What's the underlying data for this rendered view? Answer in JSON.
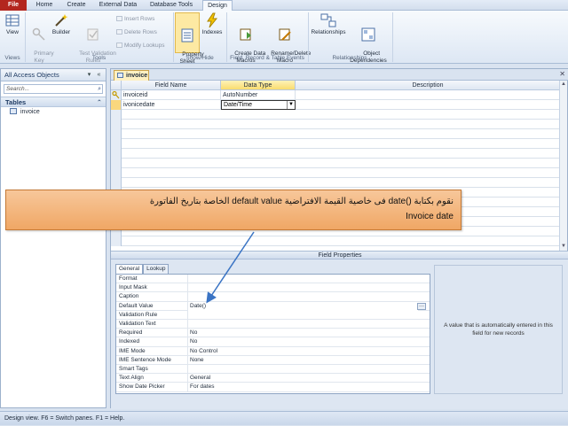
{
  "ribbon_tabs": [
    "File",
    "Home",
    "Create",
    "External Data",
    "Database Tools",
    "Design"
  ],
  "ribbon": {
    "view_label": "View",
    "primary_key_label": "Primary\nKey",
    "builder_label": "Builder",
    "test_validation_label": "Test Validation\nRules",
    "insert_rows_label": "Insert Rows",
    "delete_rows_label": "Delete Rows",
    "modify_lookups_label": "Modify Lookups",
    "property_sheet_label": "Property\nSheet",
    "indexes_label": "Indexes",
    "create_data_macros_label": "Create Data\nMacros",
    "rename_delete_macro_label": "Rename/Delete\nMacro",
    "relationships_label": "Relationships",
    "object_dependencies_label": "Object\nDependencies",
    "groups": [
      "Views",
      "Tools",
      "Show/Hide",
      "Field, Record & Table Events",
      "Relationships"
    ]
  },
  "nav": {
    "title": "All Access Objects",
    "search_placeholder": "Search...",
    "group": "Tables",
    "items": [
      "invoice"
    ]
  },
  "document": {
    "tab": "invoice",
    "headers": [
      "Field Name",
      "Data Type",
      "Description"
    ],
    "rows": [
      {
        "field": "invoiceid",
        "type": "AutoNumber",
        "description": "",
        "key": true
      },
      {
        "field": "ivonicedate",
        "type": "Date/Time",
        "description": "",
        "key": false
      }
    ]
  },
  "field_properties": {
    "bar_title": "Field Properties",
    "tabs": [
      "General",
      "Lookup"
    ],
    "rows": [
      {
        "label": "Format",
        "value": ""
      },
      {
        "label": "Input Mask",
        "value": ""
      },
      {
        "label": "Caption",
        "value": ""
      },
      {
        "label": "Default Value",
        "value": "Date()"
      },
      {
        "label": "Validation Rule",
        "value": ""
      },
      {
        "label": "Validation Text",
        "value": ""
      },
      {
        "label": "Required",
        "value": "No"
      },
      {
        "label": "Indexed",
        "value": "No"
      },
      {
        "label": "IME Mode",
        "value": "No Control"
      },
      {
        "label": "IME Sentence Mode",
        "value": "None"
      },
      {
        "label": "Smart Tags",
        "value": ""
      },
      {
        "label": "Text Align",
        "value": "General"
      },
      {
        "label": "Show Date Picker",
        "value": "For dates"
      }
    ],
    "help_text": "A value that is automatically entered in this field for new records"
  },
  "callout": {
    "line1": "نقوم بكتابة ()date  فى خاصية القيمة الافتراضية default value الخاصة بتاريخ الفاتورة",
    "line2": "Invoice date"
  },
  "status_bar": "Design view.  F6 = Switch panes.  F1 = Help.",
  "colors": {
    "file_tab": "#b3261e",
    "callout": "#f0a765",
    "selected": "#fde9a3",
    "arrow": "#3a74c4"
  }
}
